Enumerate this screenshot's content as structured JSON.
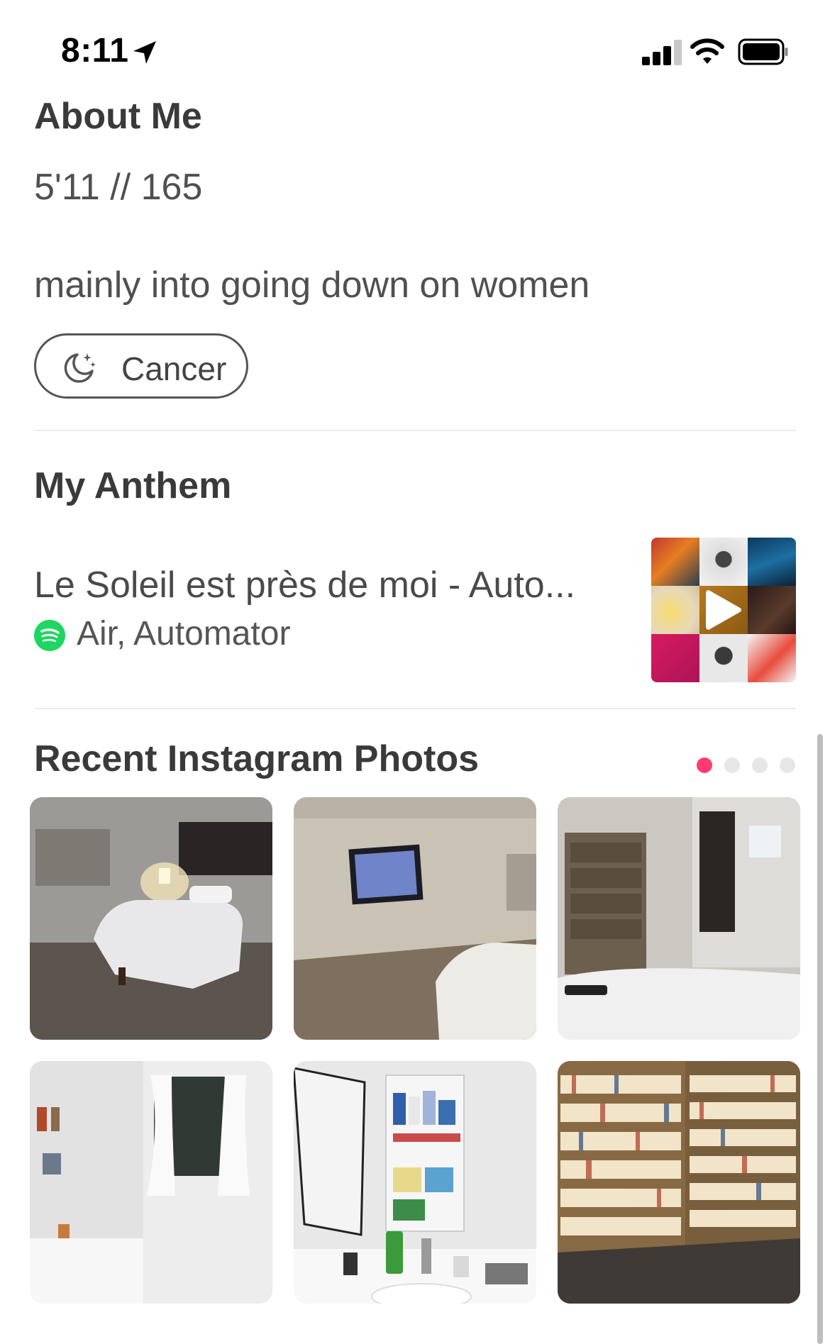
{
  "status_bar": {
    "time": "8:11"
  },
  "about": {
    "title": "About Me",
    "stats": "5'11 // 165",
    "bio": "mainly into going down on women",
    "zodiac": "Cancer"
  },
  "anthem": {
    "title": "My Anthem",
    "song": "Le Soleil est près de moi - Auto...",
    "artist": "Air, Automator"
  },
  "instagram": {
    "title": "Recent Instagram Photos",
    "page_count": 4,
    "active_page": 1,
    "photos": [
      "bedroom-photo",
      "tv-room-photo",
      "dresser-closet-photo",
      "bathroom-tub-photo",
      "medicine-cabinet-photo",
      "bookshelves-photo"
    ]
  },
  "colors": {
    "accent": "#fe3c72",
    "spotify": "#1ed760",
    "text": "#424242"
  }
}
